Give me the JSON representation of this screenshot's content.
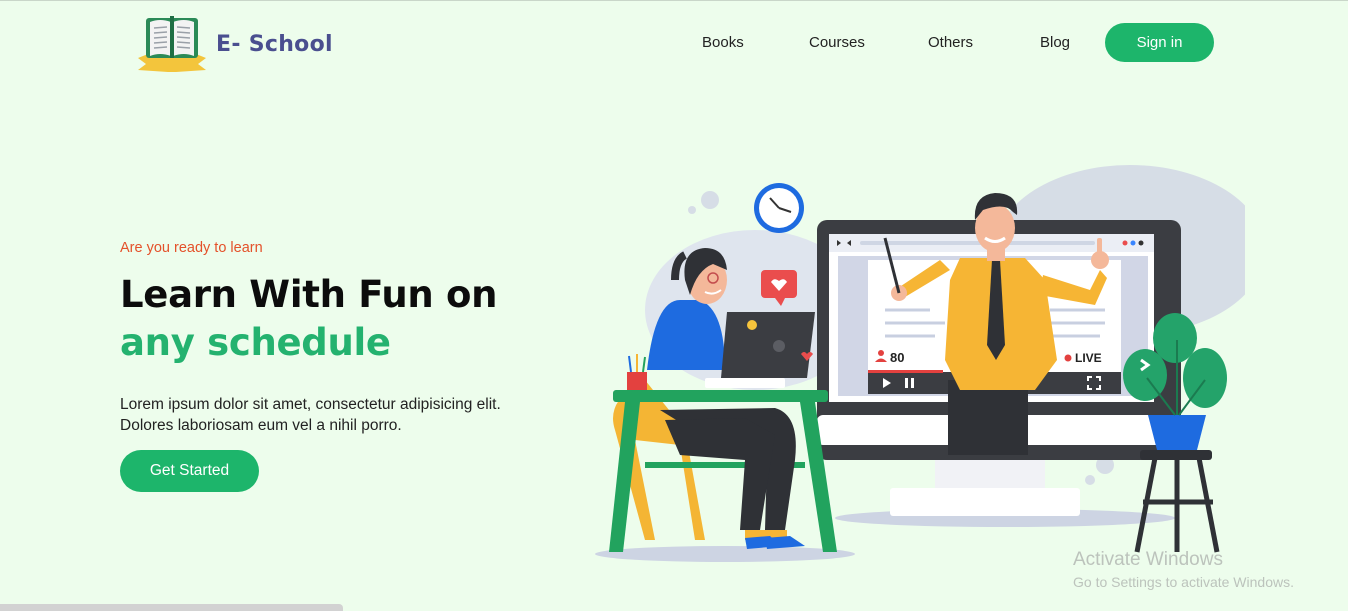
{
  "app": {
    "brand": "E- School",
    "logo_icon": "open-book-icon"
  },
  "nav": {
    "items": [
      {
        "label": "Books"
      },
      {
        "label": "Courses"
      },
      {
        "label": "Others"
      },
      {
        "label": "Blog"
      }
    ],
    "signin_label": "Sign in"
  },
  "hero": {
    "eyebrow": "Are you ready to learn",
    "headline_main": "Learn With Fun on ",
    "headline_accent": "any schedule",
    "lead": "Lorem ipsum dolor sit amet, consectetur adipisicing elit. Dolores laboriosam eum vel a nihil porro.",
    "cta_label": "Get Started"
  },
  "illustration": {
    "viewer_count": "80",
    "live_label": "LIVE",
    "icons": [
      "clock-icon",
      "heart-icon",
      "play-icon",
      "pause-icon",
      "fullscreen-icon",
      "user-icon",
      "chevron-right-icon"
    ]
  },
  "watermark": {
    "title": "Activate Windows",
    "subtitle": "Go to Settings to activate Windows."
  },
  "colors": {
    "background": "#edfdec",
    "brand_green": "#1db56b",
    "accent_text_green": "#24b26f",
    "eyebrow_orange": "#e4512a",
    "brand_text": "#4a4f8f"
  }
}
